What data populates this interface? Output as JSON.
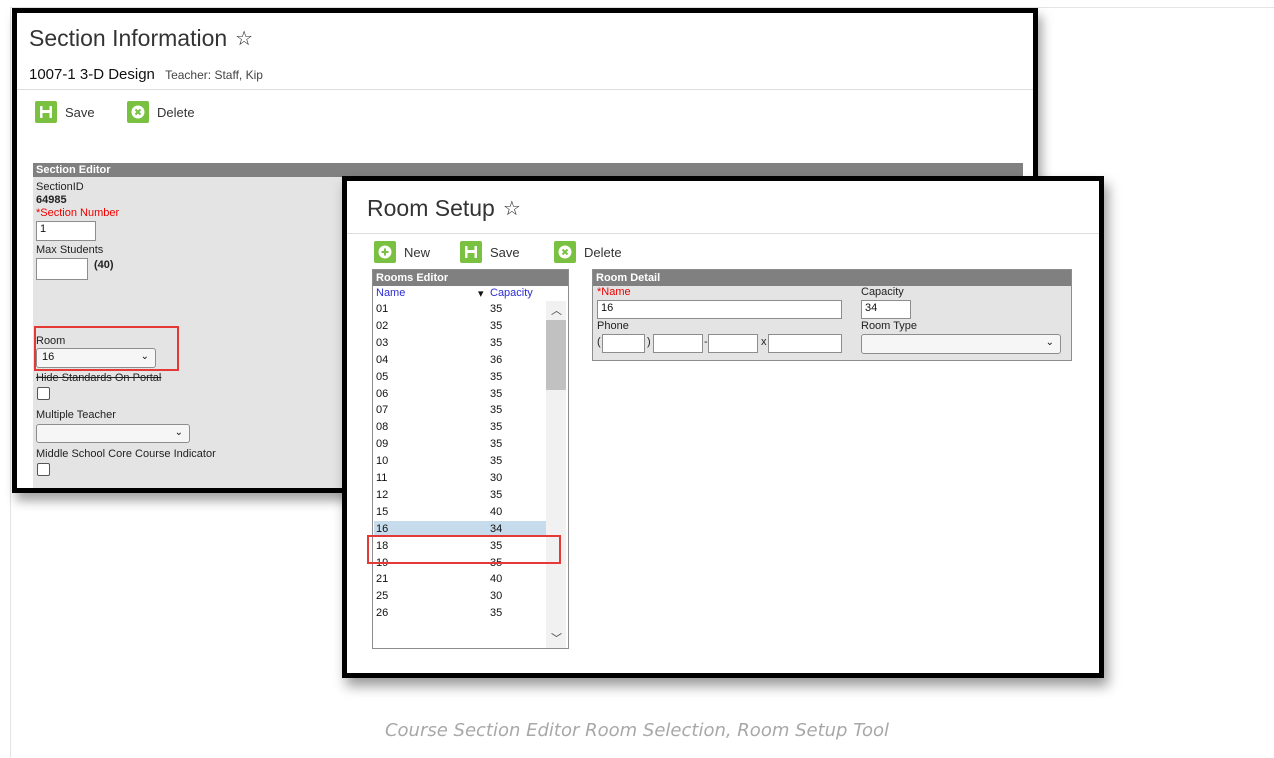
{
  "section_window": {
    "title": "Section Information",
    "course": "1007-1 3-D Design",
    "teacher": "Teacher: Staff, Kip",
    "toolbar": {
      "save_label": "Save",
      "delete_label": "Delete"
    },
    "editor": {
      "header": "Section Editor",
      "section_id_label": "SectionID",
      "section_id_value": "64985",
      "section_number_label": "*Section Number",
      "section_number_value": "1",
      "max_students_label": "Max Students",
      "max_students_value": "",
      "max_students_hint": "(40)",
      "room_label": "Room",
      "room_value": "16",
      "hide_standards_label": "Hide Standards On Portal",
      "multiple_teacher_label": "Multiple Teacher",
      "multiple_teacher_value": "",
      "middle_school_label": "Middle School Core Course Indicator"
    }
  },
  "room_window": {
    "title": "Room Setup",
    "toolbar": {
      "new_label": "New",
      "save_label": "Save",
      "delete_label": "Delete"
    },
    "rooms_editor": {
      "header": "Rooms Editor",
      "col_name": "Name",
      "col_capacity": "Capacity",
      "rows": [
        {
          "name": "01",
          "capacity": "35"
        },
        {
          "name": "02",
          "capacity": "35"
        },
        {
          "name": "03",
          "capacity": "35"
        },
        {
          "name": "04",
          "capacity": "36"
        },
        {
          "name": "05",
          "capacity": "35"
        },
        {
          "name": "06",
          "capacity": "35"
        },
        {
          "name": "07",
          "capacity": "35"
        },
        {
          "name": "08",
          "capacity": "35"
        },
        {
          "name": "09",
          "capacity": "35"
        },
        {
          "name": "10",
          "capacity": "35"
        },
        {
          "name": "11",
          "capacity": "30"
        },
        {
          "name": "12",
          "capacity": "35"
        },
        {
          "name": "15",
          "capacity": "40"
        },
        {
          "name": "16",
          "capacity": "34"
        },
        {
          "name": "18",
          "capacity": "35"
        },
        {
          "name": "19",
          "capacity": "35"
        },
        {
          "name": "21",
          "capacity": "40"
        },
        {
          "name": "25",
          "capacity": "30"
        },
        {
          "name": "26",
          "capacity": "35"
        }
      ],
      "selected_row": "16"
    },
    "room_detail": {
      "header": "Room Detail",
      "name_label": "*Name",
      "name_value": "16",
      "capacity_label": "Capacity",
      "capacity_value": "34",
      "phone_label": "Phone",
      "room_type_label": "Room Type",
      "room_type_value": ""
    }
  },
  "caption": "Course Section Editor Room Selection, Room Setup Tool",
  "colors": {
    "accent_green": "#7ac142",
    "header_gray": "#808080",
    "highlight_red": "#e53935",
    "selected_row": "#c6dcec"
  }
}
